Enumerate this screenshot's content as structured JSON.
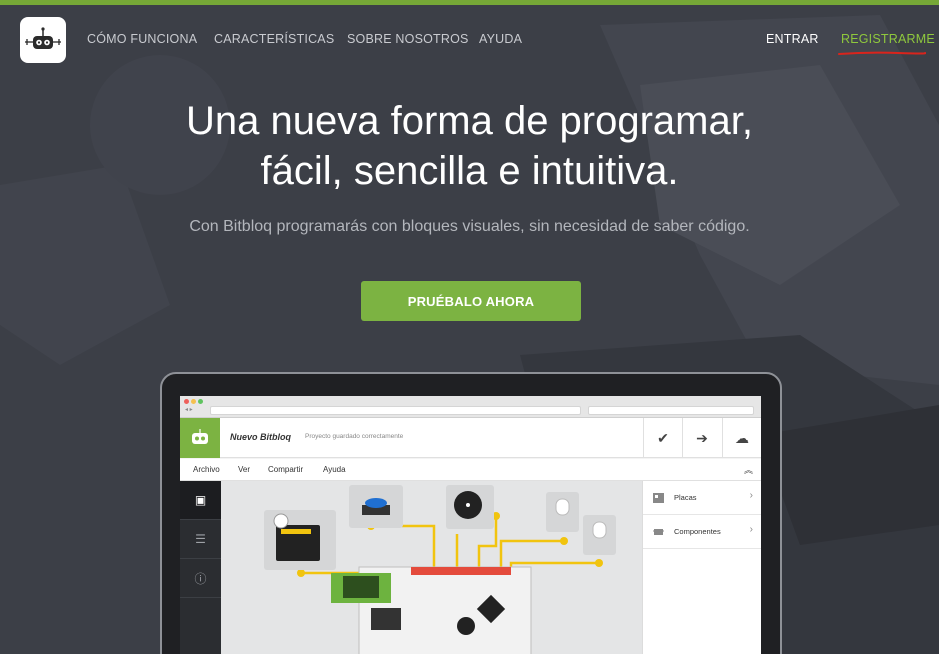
{
  "colors": {
    "brand_green": "#7cb342",
    "top_bar": "#76a837",
    "background": "#3c3f47",
    "register_link": "#8fc83d",
    "annotation_red": "#d9241c",
    "wire_yellow": "#f1c40f"
  },
  "nav": {
    "logo_icon": "bitbloq-robot-icon",
    "links": [
      {
        "label": "CÓMO FUNCIONA"
      },
      {
        "label": "CARACTERÍSTICAS"
      },
      {
        "label": "SOBRE NOSOTROS"
      },
      {
        "label": "AYUDA"
      }
    ],
    "login_label": "ENTRAR",
    "register_label": "REGISTRARME"
  },
  "hero": {
    "title_line1": "Una nueva forma de programar,",
    "title_line2": "fácil, sencilla e intuitiva.",
    "subtitle": "Con Bitbloq programarás con bloques visuales, sin necesidad de saber código.",
    "cta_label": "PRUÉBALO AHORA"
  },
  "app_preview": {
    "project_name": "Nuevo Bitbloq",
    "project_status": "Proyecto guardado correctamente",
    "header_actions": [
      {
        "icon": "check-icon",
        "glyph": "✔"
      },
      {
        "icon": "arrow-right-icon",
        "glyph": "➔"
      },
      {
        "icon": "cloud-icon",
        "glyph": "☁"
      }
    ],
    "menu": [
      "Archivo",
      "Ver",
      "Compartir",
      "Ayuda"
    ],
    "menu_collapse_glyph": "︽",
    "side_tabs": [
      {
        "icon": "chip-icon",
        "glyph": "▣"
      },
      {
        "icon": "list-icon",
        "glyph": "☰"
      },
      {
        "icon": "info-icon",
        "glyph": "ⓘ"
      }
    ],
    "panel_items": [
      {
        "label": "Placas",
        "icon": "boards-icon"
      },
      {
        "label": "Componentes",
        "icon": "components-icon"
      }
    ],
    "chevron_glyph": "›"
  }
}
